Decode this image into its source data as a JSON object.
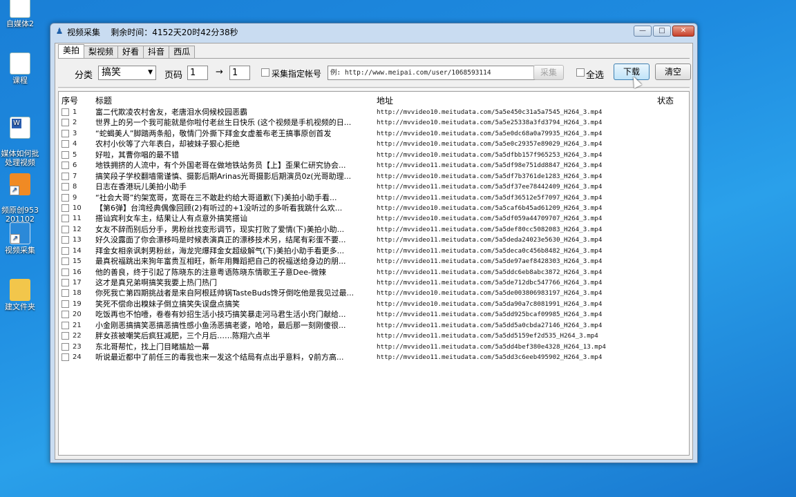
{
  "desktop": {
    "icons": [
      {
        "label": "自媒体2",
        "icon": "document-icon"
      },
      {
        "label": "课程",
        "icon": "document-icon"
      },
      {
        "label": "媒体如何批\n处理视频",
        "icon": "word-icon"
      },
      {
        "label": "频原创953\n201102",
        "icon": "app-icon"
      },
      {
        "label": "视频采集",
        "icon": "app-icon"
      },
      {
        "label": "建文件夹",
        "icon": "folder-icon"
      }
    ]
  },
  "window": {
    "title": "视频采集    剩余时间：4152天20时42分38秒",
    "buttons": {
      "minimize": "—",
      "maximize": "□",
      "close": "✕"
    }
  },
  "tabs": [
    {
      "label": "美拍",
      "active": true
    },
    {
      "label": "梨视频",
      "active": false
    },
    {
      "label": "好看",
      "active": false
    },
    {
      "label": "抖音",
      "active": false
    },
    {
      "label": "西瓜",
      "active": false
    }
  ],
  "toolbar": {
    "category_label": "分类",
    "category_value": "搞笑",
    "page_label": "页码",
    "page_from": "1",
    "arrow": "→",
    "page_to": "1",
    "specific_account_label": "采集指定帐号",
    "url_value": "例: http://www.meipai.com/user/1068593114",
    "collect_label": "采集",
    "select_all_label": "全选",
    "download_label": "下载",
    "clear_label": "清空"
  },
  "list": {
    "headers": {
      "no": "序号",
      "title": "标题",
      "address": "地址",
      "status": "状态"
    },
    "rows": [
      {
        "no": "1",
        "title": "富二代欺凌农村舍友，老唐泪水伺候校园恶霸",
        "address": "http://mvvideo10.meitudata.com/5a5e450c31a5a7545_H264_3.mp4"
      },
      {
        "no": "2",
        "title": "世界上的另一个我可能就是你啦付老丝生日快乐 (这个视频是手机视频的日...",
        "address": "http://mvvideo10.meitudata.com/5a5e25338a3fd3794_H264_3.mp4"
      },
      {
        "no": "3",
        "title": "“蛇蝎美人”脚踏两条船，敬情门外撕下拜金女虚羞布老王搞事原创首发",
        "address": "http://mvvideo10.meitudata.com/5a5e0dc68a0a79935_H264_3.mp4"
      },
      {
        "no": "4",
        "title": "农村小伙等了六年表白，却被妹子狠心拒绝",
        "address": "http://mvvideo10.meitudata.com/5a5e0c29357e89029_H264_3.mp4"
      },
      {
        "no": "5",
        "title": "好啦，其曹你唱的最不错",
        "address": "http://mvvideo10.meitudata.com/5a5dfbb157f965253_H264_3.mp4"
      },
      {
        "no": "6",
        "title": "地铁拥挤的人流中，有个外国老哥在做地铁站务员【上】歪果仁研究协会...",
        "address": "http://mvvideo11.meitudata.com/5a5df98e751dd8847_H264_3.mp4"
      },
      {
        "no": "7",
        "title": "搞笑段子学校翻墙需谨慎、摄影后期Arinas光哥摄影后期演员0z(光哥助理...",
        "address": "http://mvvideo10.meitudata.com/5a5df7b3761de1283_H264_3.mp4"
      },
      {
        "no": "8",
        "title": "日志在香港玩儿美拍小助手",
        "address": "http://mvvideo11.meitudata.com/5a5df37ee78442409_H264_3.mp4"
      },
      {
        "no": "9",
        "title": "“社会大哥”约架宽哥，宽哥在三不敢赴约给大哥道歉(下)美拍小助手看...",
        "address": "http://mvvideo11.meitudata.com/5a5df36512e5f7097_H264_3.mp4"
      },
      {
        "no": "10",
        "title": "【第6弹】台湾经典偶像回顾(2)有听过的+1没听过的多听看我跳什么欢...",
        "address": "http://mvvideo10.meitudata.com/5a5caf6b45ad61209_H264_3.mp4"
      },
      {
        "no": "11",
        "title": "搭讪宾利女车主，结果让人有点意外搞笑搭讪",
        "address": "http://mvvideo10.meitudata.com/5a5df059a44709707_H264_3.mp4"
      },
      {
        "no": "12",
        "title": "女友不辞而别后分手，男粉丝找变形调节，现实打败了爱情(下)美拍小助...",
        "address": "http://mvvideo11.meitudata.com/5a5def80cc5082083_H264_3.mp4"
      },
      {
        "no": "13",
        "title": "好久没露面了你会漂移吗是时候表演真正的漂移技术另，结尾有彩蛋不要...",
        "address": "http://mvvideo11.meitudata.com/5a5deda24023e5630_H264_3.mp4"
      },
      {
        "no": "14",
        "title": "拜金女相亲讽刺男粉丝，海龙完爆拜金女超级解气(下)美拍小助手看更多...",
        "address": "http://mvvideo11.meitudata.com/5a5deca0c456b8482_H264_3.mp4"
      },
      {
        "no": "15",
        "title": "最真祝福跳出来狗年富贵互相旺，新年用舞蹈把自己的祝福送给身边的朋...",
        "address": "http://mvvideo11.meitudata.com/5a5de97aef8428303_H264_3.mp4"
      },
      {
        "no": "16",
        "title": "他的善良，终于引起了陈晓东的注意粤语陈晓东情歌王子意Dee-微辣",
        "address": "http://mvvideo11.meitudata.com/5a5ddc6eb8abc3872_H264_3.mp4"
      },
      {
        "no": "17",
        "title": "这才是真兄弟啊搞笑我要上热门热门",
        "address": "http://mvvideo11.meitudata.com/5a5de712dbc547766_H264_3.mp4"
      },
      {
        "no": "18",
        "title": "你死我亡第四期挑战者是来自阿根廷帅锅TasteBuds馋牙倒吃他是我见过最...",
        "address": "http://mvvideo10.meitudata.com/5a5de003806983197_H264_3.mp4"
      },
      {
        "no": "19",
        "title": "笑死不偿命出糗妹子倒立搞笑失误盘点搞笑",
        "address": "http://mvvideo10.meitudata.com/5a5da90a7c8081991_H264_3.mp4"
      },
      {
        "no": "20",
        "title": "吃饭再也不怕噎，卷卷有妙招生活小技巧搞笑暴走河马君生活小窍门献给...",
        "address": "http://mvvideo11.meitudata.com/5a5dd925bcaf09985_H264_3.mp4"
      },
      {
        "no": "21",
        "title": "小金刚恶搞搞笑恶搞恶搞性感小鱼汤恶搞老婆，哈哈，最后那一刻刚傻很...",
        "address": "http://mvvideo11.meitudata.com/5a5dd5a0cbda27146_H264_3.mp4"
      },
      {
        "no": "22",
        "title": "胖女孩被嘲笑后疯狂减肥，三个月后……陈翔六点半",
        "address": "http://mvvideo11.meitudata.com/5a5dd5159ef2d535_H264_3.mp4"
      },
      {
        "no": "23",
        "title": "东北哥帮忙，找上门目睹尴尬一幕",
        "address": "http://mvvideo11.meitudata.com/5a5dd4bef380e4328_H264_13.mp4"
      },
      {
        "no": "24",
        "title": "听说最近都中了前任三的毒我也来一发这个结局有点出乎意料，♀前方高...",
        "address": "http://mvvideo11.meitudata.com/5a5dd3c6eeb495902_H264_3.mp4"
      }
    ]
  }
}
